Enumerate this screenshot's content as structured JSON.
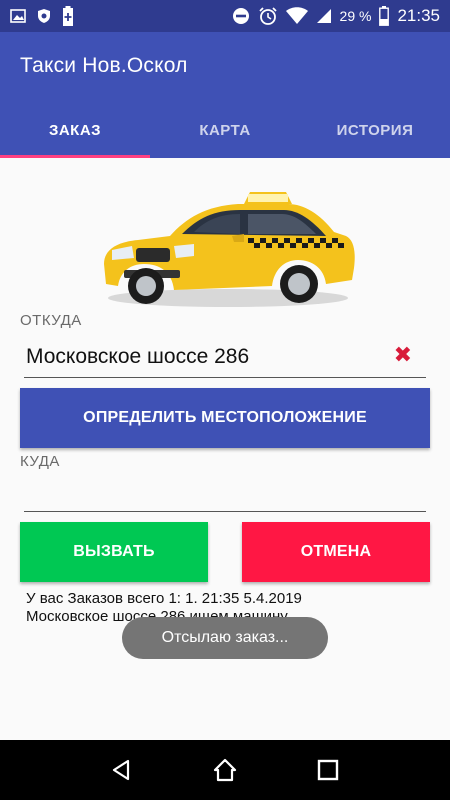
{
  "status_bar": {
    "battery_percent": "29 %",
    "time": "21:35",
    "left_icons": [
      "image-icon",
      "shield-icon",
      "battery-plus-icon"
    ],
    "right_icons": [
      "do-not-disturb-icon",
      "alarm-icon",
      "wifi-icon",
      "signal-icon",
      "battery-icon"
    ]
  },
  "app_bar": {
    "title": "Такси Нов.Оскол",
    "tabs": [
      {
        "label": "ЗАКАЗ",
        "active": true
      },
      {
        "label": "КАРТА",
        "active": false
      },
      {
        "label": "ИСТОРИЯ",
        "active": false
      }
    ],
    "colors": {
      "primary": "#3f51b5",
      "status": "#2f3b8f",
      "indicator": "#ff4081"
    }
  },
  "order_form": {
    "from_label": "ОТКУДА",
    "from_value": "Московское шоссе 286",
    "locate_button": "ОПРЕДЕЛИТЬ МЕСТОПОЛОЖЕНИЕ",
    "to_label": "КУДА",
    "to_value": "",
    "call_button": "ВЫЗВАТЬ",
    "cancel_button": "ОТМЕНА",
    "orders_line1": "У вас Заказов всего 1:  1. 21:35 5.4.2019",
    "orders_line2": "Московское шоссе 286  ищем машину"
  },
  "toast": {
    "text": "Отсылаю заказ..."
  },
  "nav_bar": {
    "buttons": [
      "back-icon",
      "home-icon",
      "recents-icon"
    ]
  }
}
